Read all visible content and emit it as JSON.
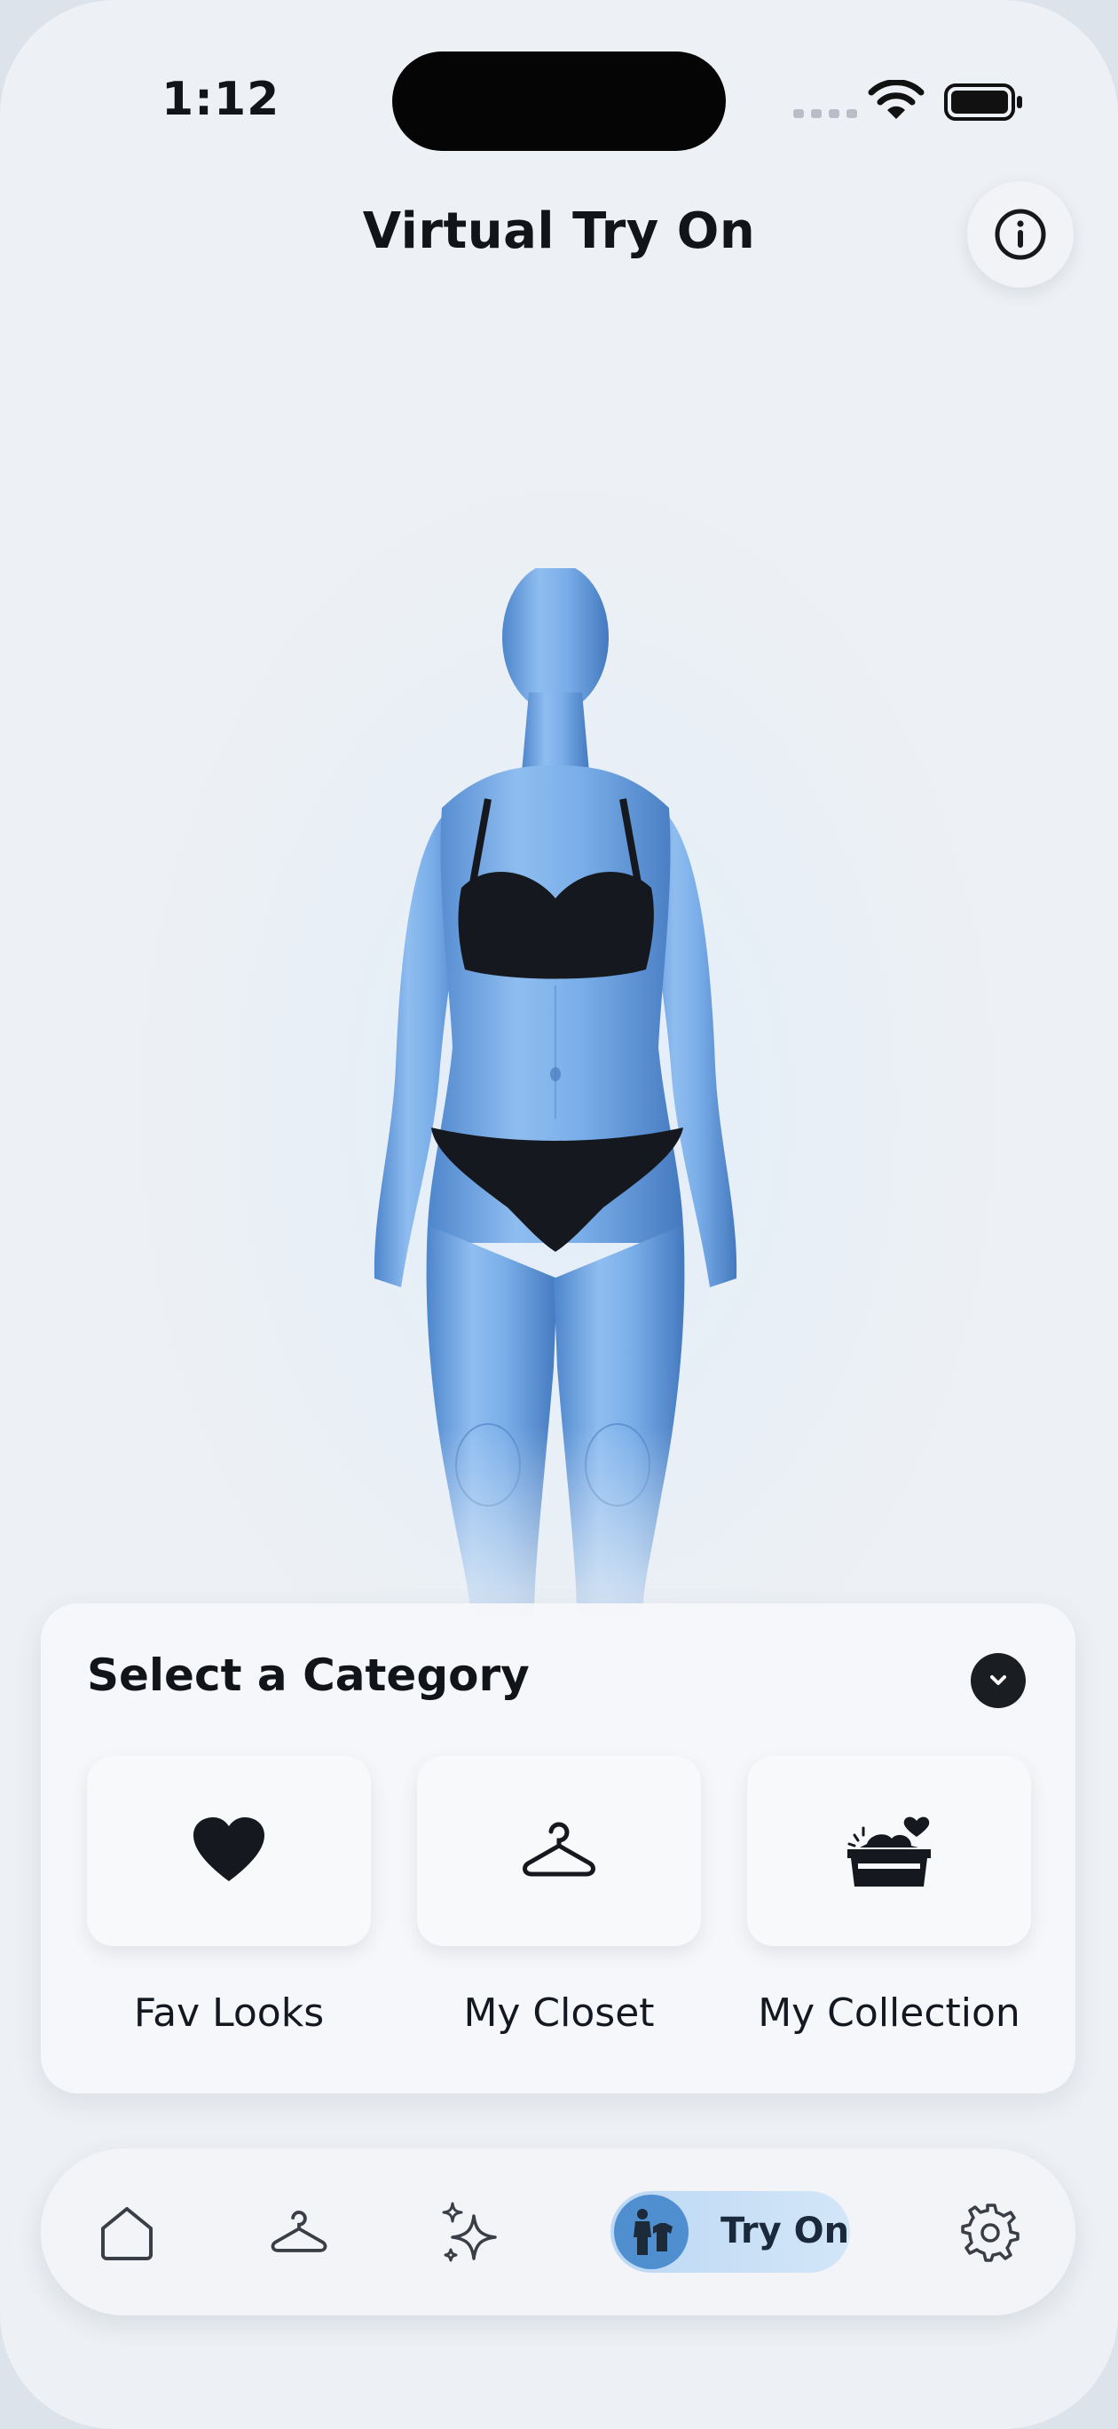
{
  "status_bar": {
    "time": "1:12"
  },
  "header": {
    "title": "Virtual Try On",
    "info_icon": "info-icon"
  },
  "category_panel": {
    "heading": "Select a Category",
    "toggle_icon": "chevron-down-icon",
    "items": [
      {
        "label": "Fav Looks",
        "icon": "heart-icon"
      },
      {
        "label": "My Closet",
        "icon": "hanger-icon"
      },
      {
        "label": "My Collection",
        "icon": "collection-box-icon"
      }
    ]
  },
  "bottom_nav": {
    "items": [
      {
        "name": "home",
        "icon": "home-icon"
      },
      {
        "name": "closet",
        "icon": "hanger-icon"
      },
      {
        "name": "ai-styling",
        "icon": "sparkles-icon"
      },
      {
        "name": "try-on",
        "icon": "try-on-icon",
        "label": "Try On",
        "active": true
      },
      {
        "name": "settings",
        "icon": "gear-icon"
      }
    ]
  },
  "colors": {
    "accent": "#4f8fd0",
    "active_pill": "#c5def6",
    "text": "#111418",
    "mannequin": "#6fa6e6"
  }
}
